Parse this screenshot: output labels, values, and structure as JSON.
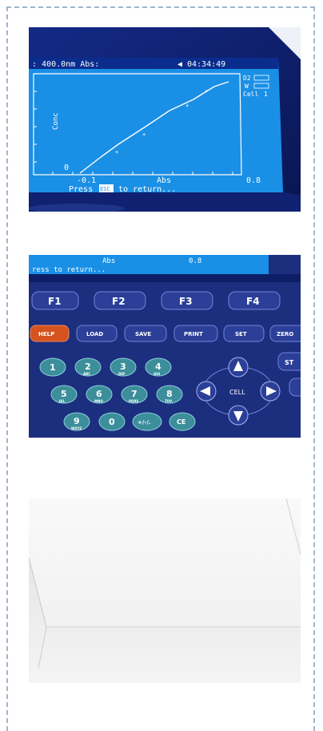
{
  "screen": {
    "status_left": ": 400.0nm Abs:",
    "status_time": "04:34:49",
    "axis_y_label": "Conc",
    "axis_x_label": "Abs",
    "x_min": "-0.1",
    "x_max": "0.8",
    "y_zero": "0",
    "side_labels": [
      "D2",
      "W",
      "Cell"
    ],
    "cell_number": "1",
    "footer_prefix": "Press",
    "footer_key": "ESC",
    "footer_suffix": "to return..."
  },
  "keypad": {
    "screen_strip_axis": "Abs",
    "screen_strip_max": "0.8",
    "screen_strip_footer": "ress  to return...",
    "function_keys": [
      "F1",
      "F2",
      "F3",
      "F4"
    ],
    "command_keys": [
      "HELP",
      "LOAD",
      "SAVE",
      "PRINT",
      "SET",
      "ZERO"
    ],
    "numeric_keys": [
      {
        "digit": "1",
        "sub": ""
      },
      {
        "digit": "2",
        "sub": "ABC"
      },
      {
        "digit": "3",
        "sub": "DEF"
      },
      {
        "digit": "4",
        "sub": "GHI"
      },
      {
        "digit": "5",
        "sub": "JKL"
      },
      {
        "digit": "6",
        "sub": "MNO"
      },
      {
        "digit": "7",
        "sub": "PQRS"
      },
      {
        "digit": "8",
        "sub": "TUV"
      },
      {
        "digit": "9",
        "sub": "WXYZ"
      },
      {
        "digit": "0",
        "sub": ""
      }
    ],
    "sign_key": "+/-/.",
    "ce_key": "CE",
    "cell_label": "CELL",
    "side_key": "ST"
  },
  "colors": {
    "screen_blue": "#1a8fe6",
    "panel_blue": "#1a2c7c",
    "help_key": "#d5531e",
    "key_blue": "#2b3f98",
    "key_teal": "#3b8e9a"
  }
}
